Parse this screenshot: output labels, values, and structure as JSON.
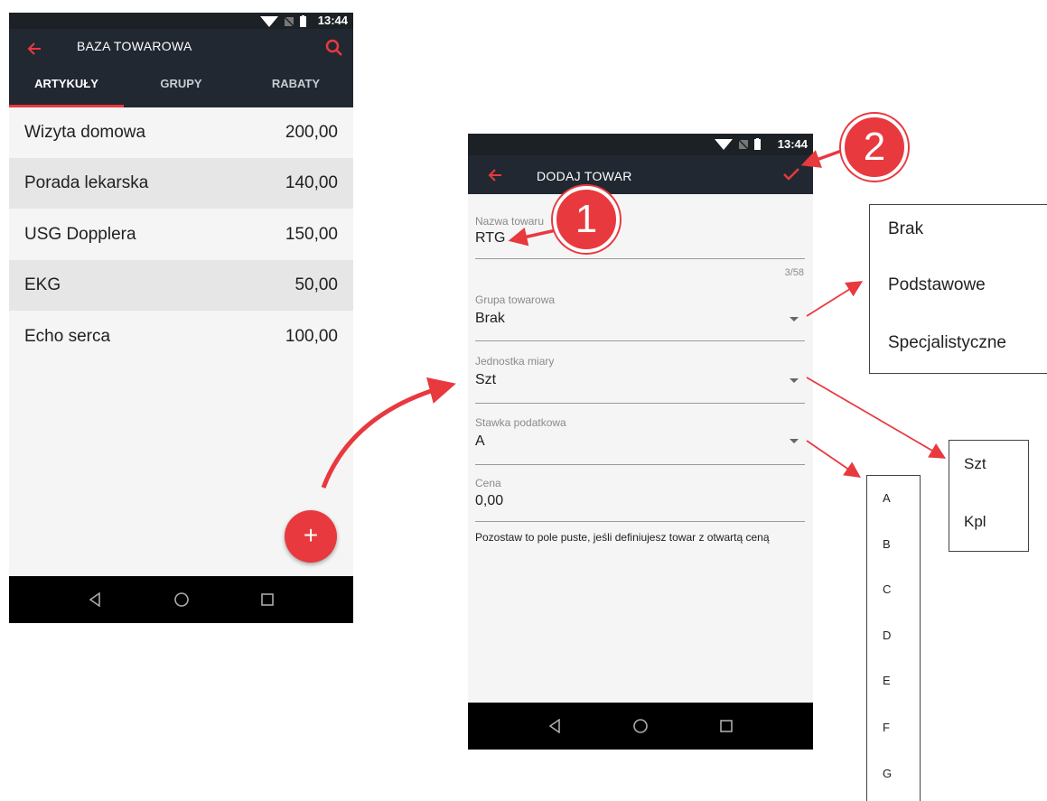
{
  "left_screen": {
    "status": {
      "time": "13:44"
    },
    "title": "BAZA TOWAROWA",
    "tabs": [
      {
        "label": "ARTYKUŁY",
        "active": true
      },
      {
        "label": "GRUPY",
        "active": false
      },
      {
        "label": "RABATY",
        "active": false
      }
    ],
    "items": [
      {
        "name": "Wizyta domowa",
        "price": "200,00"
      },
      {
        "name": "Porada lekarska",
        "price": "140,00"
      },
      {
        "name": "USG Dopplera",
        "price": "150,00"
      },
      {
        "name": "EKG",
        "price": "50,00"
      },
      {
        "name": "Echo serca",
        "price": "100,00"
      }
    ],
    "fab_label": "+"
  },
  "right_screen": {
    "status": {
      "time": "13:44"
    },
    "title": "DODAJ TOWAR",
    "fields": {
      "name": {
        "label": "Nazwa towaru",
        "value": "RTG",
        "counter": "3/58"
      },
      "group": {
        "label": "Grupa towarowa",
        "value": "Brak"
      },
      "unit": {
        "label": "Jednostka miary",
        "value": "Szt"
      },
      "tax": {
        "label": "Stawka podatkowa",
        "value": "A"
      },
      "price": {
        "label": "Cena",
        "value": "0,00",
        "hint": "Pozostaw to pole puste, jeśli definiujesz towar z otwartą ceną"
      }
    }
  },
  "popups": {
    "group_options": [
      "Brak",
      "Podstawowe",
      "Specjalistyczne"
    ],
    "unit_options": [
      "Szt",
      "Kpl"
    ],
    "tax_options": [
      "A",
      "B",
      "C",
      "D",
      "E",
      "F",
      "G"
    ]
  },
  "badges": {
    "one": "1",
    "two": "2"
  },
  "colors": {
    "accent": "#e8393f",
    "toolbar": "#222831",
    "statusbar": "#1c2126",
    "row_alt": "#e6e6e6"
  },
  "icons": [
    "back-arrow-icon",
    "search-icon",
    "check-icon",
    "wifi-icon",
    "no-sim-icon",
    "battery-icon",
    "nav-back-icon",
    "nav-home-icon",
    "nav-recents-icon",
    "plus-icon"
  ]
}
